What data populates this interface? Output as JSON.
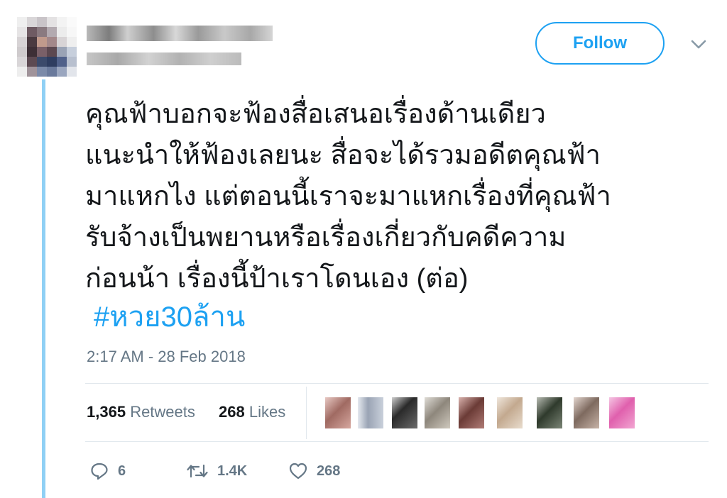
{
  "user": {
    "display_name": "",
    "handle": "",
    "follow_label": "Follow"
  },
  "tweet": {
    "lines": [
      "คุณฟ้าบอกจะฟ้องสื่อเสนอเรื่องด้านเดียว",
      "แนะนำให้ฟ้องเลยนะ สื่อจะได้รวมอดีตคุณฟ้า",
      "มาแหกไง แต่ตอนนี้เราจะมาแหกเรื่องที่คุณฟ้า",
      "รับจ้างเป็นพยานหรือเรื่องเกี่ยวกับคดีความ",
      "ก่อนน้า เรื่องนี้ป้าเราโดนเอง (ต่อ)"
    ],
    "hashtag": "#หวย30ล้าน",
    "timestamp": "2:17 AM - 28 Feb 2018"
  },
  "stats": {
    "retweets_count": "1,365",
    "retweets_label": "Retweets",
    "likes_count": "268",
    "likes_label": "Likes"
  },
  "likers_count": 9,
  "actions": {
    "replies": "6",
    "retweets": "1.4K",
    "likes": "268"
  },
  "colors": {
    "accent": "#1da1f2",
    "muted": "#657786",
    "text": "#14171a",
    "thread_line": "#8fd0f5"
  },
  "icons": [
    "avatar-blurred",
    "chevron-down-icon",
    "reply-icon",
    "retweet-icon",
    "heart-icon"
  ]
}
